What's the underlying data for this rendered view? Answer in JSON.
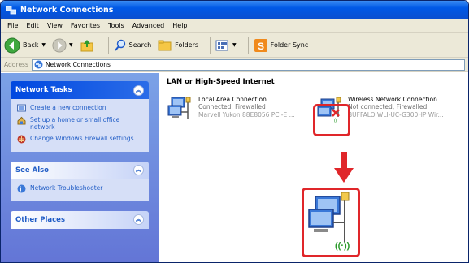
{
  "window": {
    "title": "Network Connections"
  },
  "menu": [
    "File",
    "Edit",
    "View",
    "Favorites",
    "Tools",
    "Advanced",
    "Help"
  ],
  "toolbar": {
    "back_label": "Back",
    "search_label": "Search",
    "folders_label": "Folders",
    "foldersync_label": "Folder Sync"
  },
  "address": {
    "label": "Address",
    "value": "Network Connections"
  },
  "sidebar": {
    "network_tasks": {
      "title": "Network Tasks",
      "items": [
        {
          "label": "Create a new connection",
          "icon": "new-connection-icon"
        },
        {
          "label": "Set up a home or small office network",
          "icon": "home-network-icon"
        },
        {
          "label": "Change Windows Firewall settings",
          "icon": "firewall-icon"
        }
      ]
    },
    "see_also": {
      "title": "See Also",
      "items": [
        {
          "label": "Network Troubleshooter",
          "icon": "help-icon"
        }
      ]
    },
    "other_places": {
      "title": "Other Places"
    }
  },
  "main": {
    "group_title": "LAN or High-Speed Internet",
    "connections": [
      {
        "name": "Local Area Connection",
        "status": "Connected, Firewalled",
        "device": "Marvell Yukon 88E8056 PCI-E ..."
      },
      {
        "name": "Wireless Network Connection",
        "status": "Not connected, Firewalled",
        "device": "BUFFALO WLI-UC-G300HP Wir..."
      }
    ]
  },
  "colors": {
    "highlight": "#e0262a",
    "task_pane": "#6375d6",
    "title_bar": "#0058e6"
  }
}
